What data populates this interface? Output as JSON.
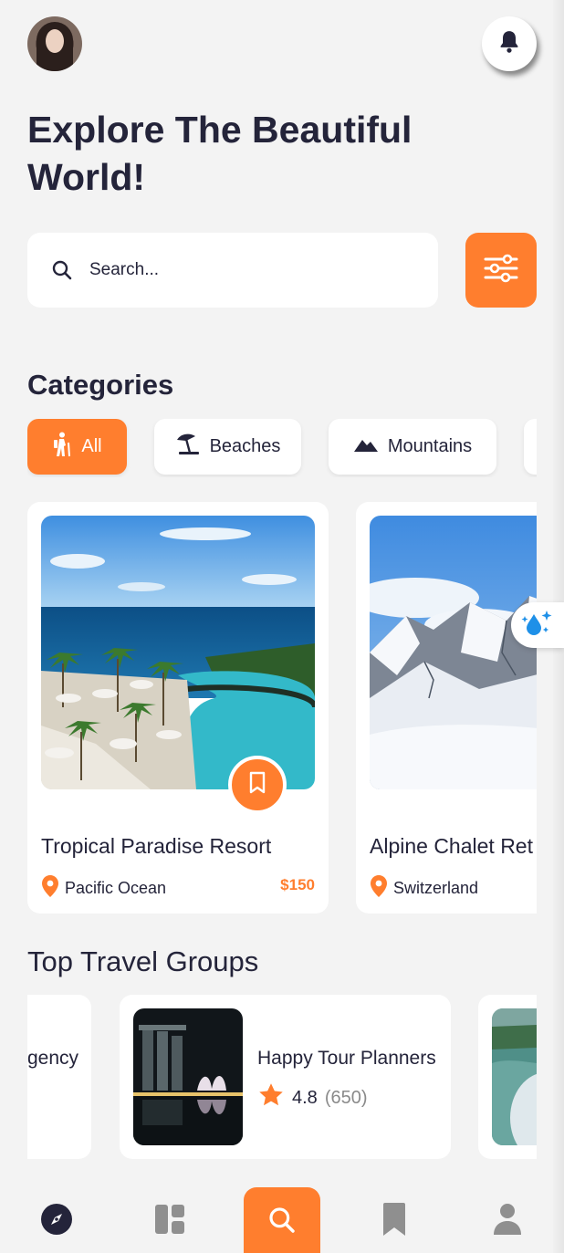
{
  "header": {
    "title": "Explore The Beautiful World!"
  },
  "search": {
    "placeholder": "Search..."
  },
  "categories": {
    "title": "Categories",
    "items": [
      {
        "label": "All",
        "icon": "hiking-icon",
        "active": true
      },
      {
        "label": "Beaches",
        "icon": "beach-umbrella-icon",
        "active": false
      },
      {
        "label": "Mountains",
        "icon": "mountain-icon",
        "active": false
      }
    ]
  },
  "places": [
    {
      "name": "Tropical Paradise Resort",
      "location": "Pacific Ocean",
      "price": "$150"
    },
    {
      "name": "Alpine Chalet Ret",
      "location": "Switzerland",
      "price": ""
    }
  ],
  "groups": {
    "title": "Top Travel Groups",
    "items": [
      {
        "name": "gency"
      },
      {
        "name": "Happy Tour Planners",
        "rating": "4.8",
        "count": "(650)"
      }
    ]
  },
  "colors": {
    "accent": "#ff7e2e",
    "text": "#24243a",
    "background": "#f3f3f3"
  },
  "nav": {
    "items": [
      "compass-icon",
      "dashboard-icon",
      "search-icon",
      "bookmark-icon",
      "user-icon"
    ],
    "active": "search-icon"
  }
}
